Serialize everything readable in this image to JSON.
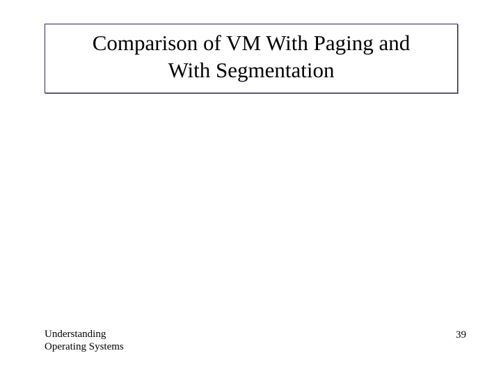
{
  "slide": {
    "title_line1": "Comparison of VM With Paging and",
    "title_line2": "With Segmentation",
    "footer_text_line1": "Understanding",
    "footer_text_line2": "Operating Systems",
    "page_number": "39"
  }
}
